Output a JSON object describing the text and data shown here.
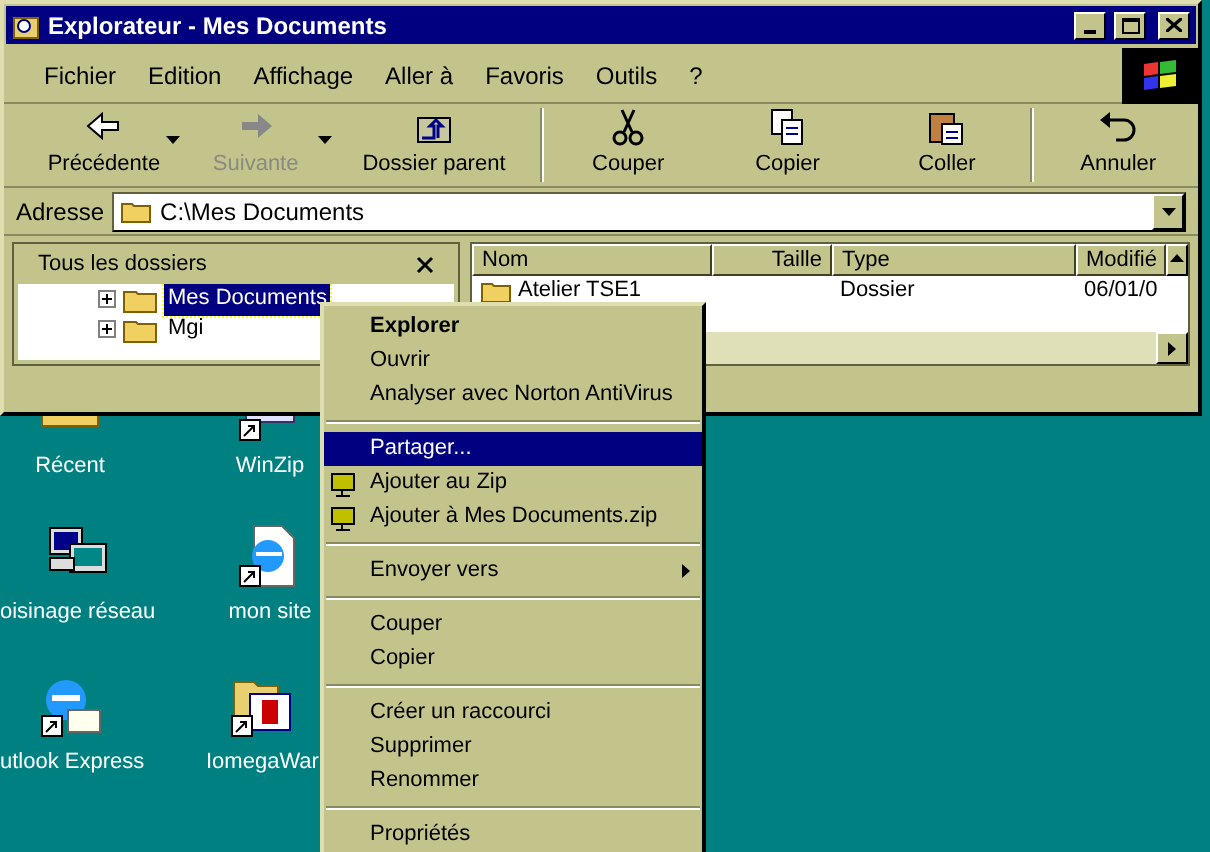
{
  "window": {
    "title": "Explorateur - Mes Documents"
  },
  "menu_bar": [
    "Fichier",
    "Edition",
    "Affichage",
    "Aller à",
    "Favoris",
    "Outils",
    "?"
  ],
  "toolbar": [
    {
      "kind": "back",
      "label": "Précédente",
      "disabled": false,
      "dropdown": true
    },
    {
      "kind": "forward",
      "label": "Suivante",
      "disabled": true,
      "dropdown": true
    },
    {
      "kind": "up",
      "label": "Dossier parent",
      "disabled": false,
      "dropdown": false
    },
    {
      "kind": "cut",
      "label": "Couper",
      "disabled": false,
      "dropdown": false
    },
    {
      "kind": "copy",
      "label": "Copier",
      "disabled": false,
      "dropdown": false
    },
    {
      "kind": "paste",
      "label": "Coller",
      "disabled": false,
      "dropdown": false
    },
    {
      "kind": "undo",
      "label": "Annuler",
      "disabled": false,
      "dropdown": false
    }
  ],
  "address": {
    "label": "Adresse",
    "value": "C:\\Mes Documents"
  },
  "folders_pane": {
    "title": "Tous les dossiers",
    "items": [
      {
        "label": "Mes Documents",
        "selected": true
      },
      {
        "label": "Mgi",
        "selected": false
      }
    ]
  },
  "file_list": {
    "columns": [
      "Nom",
      "Taille",
      "Type",
      "Modifié"
    ],
    "rows": [
      {
        "name": "Atelier TSE1",
        "size": "",
        "type": "Dossier",
        "modified": "06/01/0"
      }
    ]
  },
  "desktop_icons": [
    {
      "kind": "folder",
      "label": "Récent"
    },
    {
      "kind": "winzip",
      "label": "WinZip"
    },
    {
      "kind": "network",
      "label": "oisinage réseau"
    },
    {
      "kind": "webpage",
      "label": "mon site"
    },
    {
      "kind": "mail",
      "label": "utlook Express"
    },
    {
      "kind": "iomega",
      "label": "IomegaWar"
    }
  ],
  "context_menu": [
    {
      "kind": "item",
      "label": "Explorer",
      "default": true,
      "selected": false
    },
    {
      "kind": "item",
      "label": "Ouvrir",
      "default": false,
      "selected": false
    },
    {
      "kind": "item",
      "label": "Analyser avec Norton AntiVirus",
      "default": false,
      "selected": false
    },
    {
      "kind": "separator"
    },
    {
      "kind": "item",
      "label": "Partager...",
      "default": false,
      "selected": true
    },
    {
      "kind": "zip",
      "label": "Ajouter au Zip",
      "default": false,
      "selected": false
    },
    {
      "kind": "zip",
      "label": "Ajouter à Mes Documents.zip",
      "default": false,
      "selected": false
    },
    {
      "kind": "separator"
    },
    {
      "kind": "submenu",
      "label": "Envoyer vers",
      "default": false,
      "selected": false
    },
    {
      "kind": "separator"
    },
    {
      "kind": "item",
      "label": "Couper",
      "default": false,
      "selected": false
    },
    {
      "kind": "item",
      "label": "Copier",
      "default": false,
      "selected": false
    },
    {
      "kind": "separator"
    },
    {
      "kind": "item",
      "label": "Créer un raccourci",
      "default": false,
      "selected": false
    },
    {
      "kind": "item",
      "label": "Supprimer",
      "default": false,
      "selected": false
    },
    {
      "kind": "item",
      "label": "Renommer",
      "default": false,
      "selected": false
    },
    {
      "kind": "separator"
    },
    {
      "kind": "item",
      "label": "Propriétés",
      "default": false,
      "selected": false
    }
  ]
}
